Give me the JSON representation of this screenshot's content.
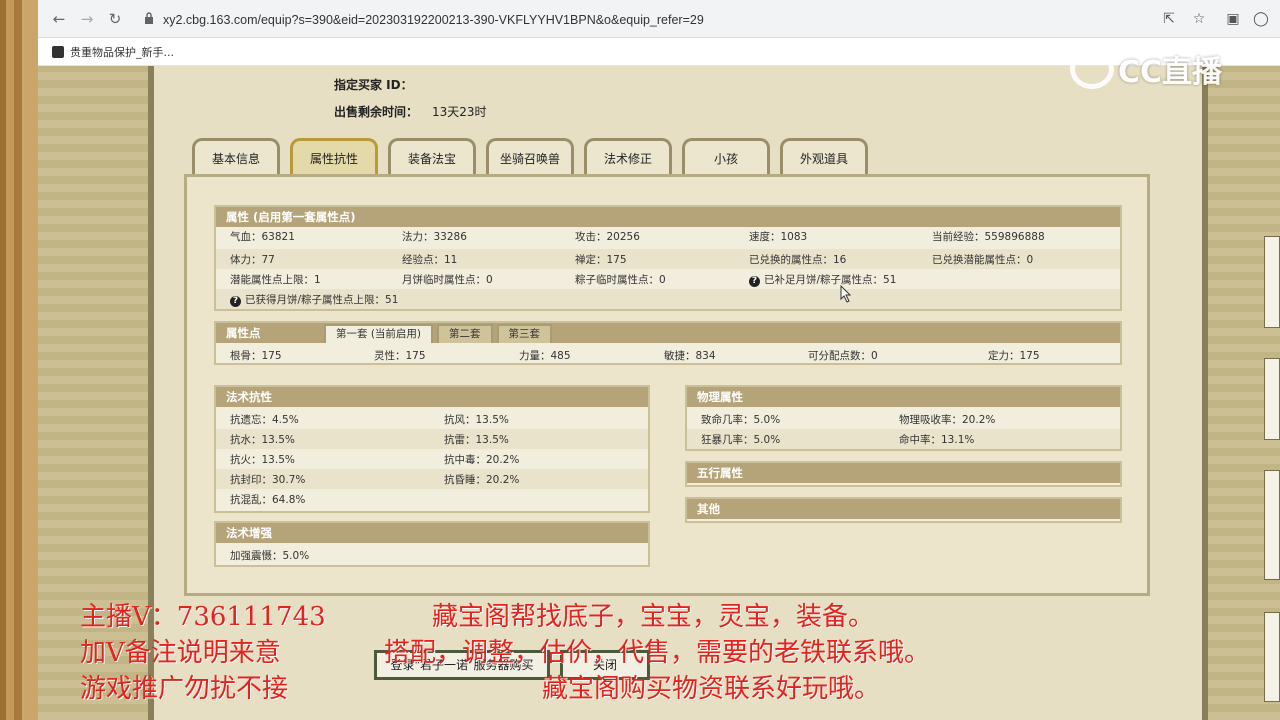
{
  "browser": {
    "url": "xy2.cbg.163.com/equip?s=390&eid=202303192200213-390-VKFLYYHV1BPN&o&equip_refer=29",
    "bookmark": "贵重物品保护_新手..."
  },
  "sale": {
    "buyer_label": "指定买家 ID：",
    "buyer_value": "",
    "remain_label": "出售剩余时间：",
    "remain_value": "13天23时"
  },
  "tabs": [
    "基本信息",
    "属性抗性",
    "装备法宝",
    "坐骑召唤兽",
    "法术修正",
    "小孩",
    "外观道具"
  ],
  "attributes": {
    "title": "属性 (启用第一套属性点)",
    "rows": [
      [
        "气血：63821",
        "法力：33286",
        "攻击：20256",
        "速度：1083",
        "当前经验：559896888"
      ],
      [
        "体力：77",
        "经验点：11",
        "禅定：175",
        "已兑换的属性点：16",
        "已兑换潜能属性点：0"
      ],
      [
        "潜能属性点上限：1",
        "月饼临时属性点：0",
        "粽子临时属性点：0",
        "已补足月饼/粽子属性点：51",
        ""
      ],
      [
        "已获得月饼/粽子属性点上限：51",
        "",
        "",
        "",
        ""
      ]
    ]
  },
  "attr_points": {
    "title": "属性点",
    "subtabs": [
      "第一套 (当前启用)",
      "第二套",
      "第三套"
    ],
    "values": [
      "根骨：175",
      "灵性：175",
      "力量：485",
      "敏捷：834",
      "可分配点数：0",
      "定力：175"
    ]
  },
  "magic_resist": {
    "title": "法术抗性",
    "rows": [
      [
        "抗遗忘：4.5%",
        "抗风：13.5%"
      ],
      [
        "抗水：13.5%",
        "抗雷：13.5%"
      ],
      [
        "抗火：13.5%",
        "抗中毒：20.2%"
      ],
      [
        "抗封印：30.7%",
        "抗昏睡：20.2%"
      ],
      [
        "抗混乱：64.8%",
        ""
      ]
    ]
  },
  "magic_boost": {
    "title": "法术增强",
    "rows": [
      "加强震慑：5.0%"
    ]
  },
  "physical": {
    "title": "物理属性",
    "rows": [
      [
        "致命几率：5.0%",
        "物理吸收率：20.2%"
      ],
      [
        "狂暴几率：5.0%",
        "命中率：13.1%"
      ]
    ]
  },
  "five_elements": {
    "title": "五行属性"
  },
  "other": {
    "title": "其他"
  },
  "bottom_buttons": {
    "login": "登录\"君子一诺\"服务器购买",
    "close": "关闭"
  },
  "overlay": {
    "logo_text": "CC直播",
    "captions": [
      "主播V：736111743",
      "加V备注说明来意",
      "游戏推广勿扰不接",
      "藏宝阁帮找底子，宝宝，灵宝，装备。",
      "搭配，调整，估价，代售，需要的老铁联系哦。",
      "藏宝阁购买物资联系好玩哦。"
    ]
  },
  "colors": {
    "header": "#b5a47a",
    "caption_red": "#e4231e",
    "panel_bg": "#ece5cb"
  }
}
